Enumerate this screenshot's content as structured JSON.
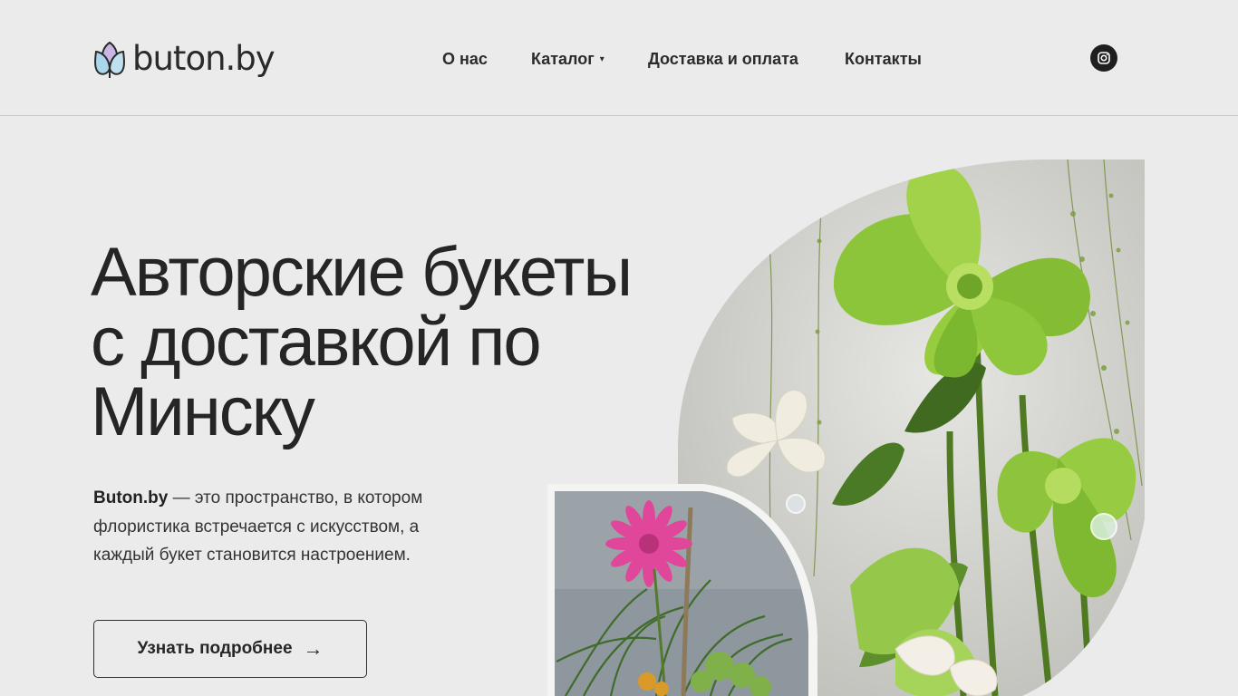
{
  "header": {
    "logo_text": "buton.by",
    "nav": [
      {
        "label": "О нас"
      },
      {
        "label": "Каталог",
        "caret": "▾"
      },
      {
        "label": "Доставка и оплата"
      },
      {
        "label": "Контакты"
      }
    ],
    "social_icon": "instagram-icon"
  },
  "hero": {
    "title_lines": [
      "Авторские букеты",
      "с доставкой по",
      "Минску"
    ],
    "description_brand": "Buton.by",
    "description_rest": " — это пространство, в котором флористика встречается с искусством, а каждый букет становится настроением.",
    "button_label": "Узнать подробнее",
    "button_arrow": "→"
  },
  "colors": {
    "background": "#ebebeb",
    "text": "#252525",
    "leaf_green": "#8fc42a",
    "pink": "#e0479a"
  }
}
